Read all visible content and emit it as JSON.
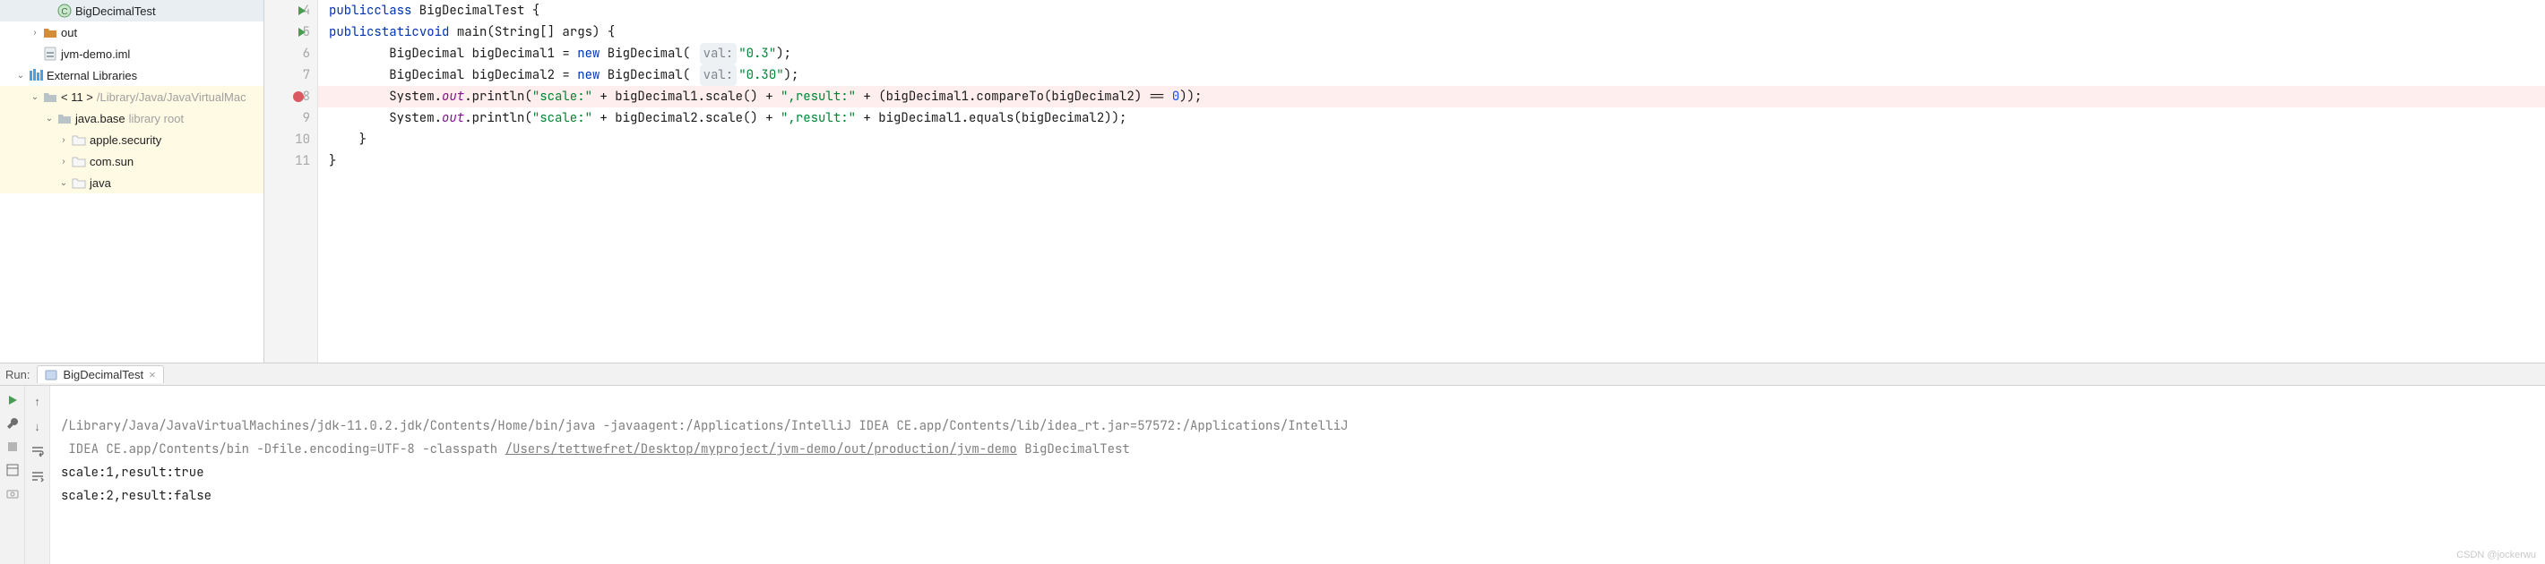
{
  "tree": {
    "items": [
      {
        "indent": 2,
        "arrow": "",
        "icon": "java-class",
        "label": "BigDecimalTest",
        "suffix": "",
        "cls": "row-cur"
      },
      {
        "indent": 1,
        "arrow": ">",
        "icon": "folder-orange",
        "label": "out",
        "suffix": "",
        "cls": ""
      },
      {
        "indent": 1,
        "arrow": "",
        "icon": "iml",
        "label": "jvm-demo.iml",
        "suffix": "",
        "cls": ""
      },
      {
        "indent": 0,
        "arrow": "v",
        "icon": "libs",
        "label": "External Libraries",
        "suffix": "",
        "cls": ""
      },
      {
        "indent": 1,
        "arrow": "v",
        "icon": "folder-gray",
        "label": "< 11 >",
        "suffix": "/Library/Java/JavaVirtualMac",
        "cls": "row-hl"
      },
      {
        "indent": 2,
        "arrow": "v",
        "icon": "folder-gray",
        "label": "java.base",
        "suffix": "library root",
        "cls": "row-hl"
      },
      {
        "indent": 3,
        "arrow": ">",
        "icon": "dir-white",
        "label": "apple.security",
        "suffix": "",
        "cls": "row-hl"
      },
      {
        "indent": 3,
        "arrow": ">",
        "icon": "dir-white",
        "label": "com.sun",
        "suffix": "",
        "cls": "row-hl"
      },
      {
        "indent": 3,
        "arrow": "v",
        "icon": "dir-white",
        "label": "java",
        "suffix": "",
        "cls": "row-hl"
      }
    ]
  },
  "editor": {
    "gutter": [
      {
        "num": "4",
        "run": true,
        "brk": false
      },
      {
        "num": "5",
        "run": true,
        "brk": false
      },
      {
        "num": "6",
        "run": false,
        "brk": false
      },
      {
        "num": "7",
        "run": false,
        "brk": false
      },
      {
        "num": "8",
        "run": false,
        "brk": true
      },
      {
        "num": "9",
        "run": false,
        "brk": false
      },
      {
        "num": "10",
        "run": false,
        "brk": false
      },
      {
        "num": "11",
        "run": false,
        "brk": false
      }
    ],
    "strings": {
      "val_hint": "val:",
      "s03": "\"0.3\"",
      "s030": "\"0.30\"",
      "s_scale": "\"scale:\"",
      "s_result": "\",result:\"",
      "zero": "0"
    }
  },
  "run": {
    "label": "Run:",
    "tab": "BigDecimalTest",
    "console": {
      "cmd1": "/Library/Java/JavaVirtualMachines/jdk-11.0.2.jdk/Contents/Home/bin/java -javaagent:/Applications/IntelliJ IDEA CE.app/Contents/lib/idea_rt.jar=57572:/Applications/IntelliJ",
      "cmd2_a": " IDEA CE.app/Contents/bin -Dfile.encoding=UTF-8 -classpath ",
      "cmd2_link": "/Users/tettwefret/Desktop/myproject/jvm-demo/out/production/jvm-demo",
      "cmd2_b": " BigDecimalTest",
      "out1": "scale:1,result:true",
      "out2": "scale:2,result:false"
    }
  },
  "watermark": "CSDN @jockerwu"
}
